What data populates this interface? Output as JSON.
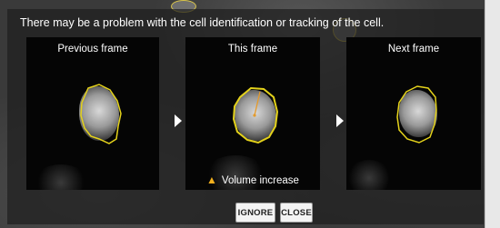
{
  "dialog": {
    "message": "There may be a problem with the cell identification or tracking of the cell."
  },
  "frames": {
    "previous_label": "Previous frame",
    "this_label": "This frame",
    "next_label": "Next frame"
  },
  "warning": {
    "icon": "warning-icon",
    "text": "Volume increase"
  },
  "buttons": {
    "ignore_label": "IGNORE",
    "close_label": "CLOSE"
  },
  "colors": {
    "outline": "#e4d21b",
    "warning_icon": "#f2b01e"
  }
}
